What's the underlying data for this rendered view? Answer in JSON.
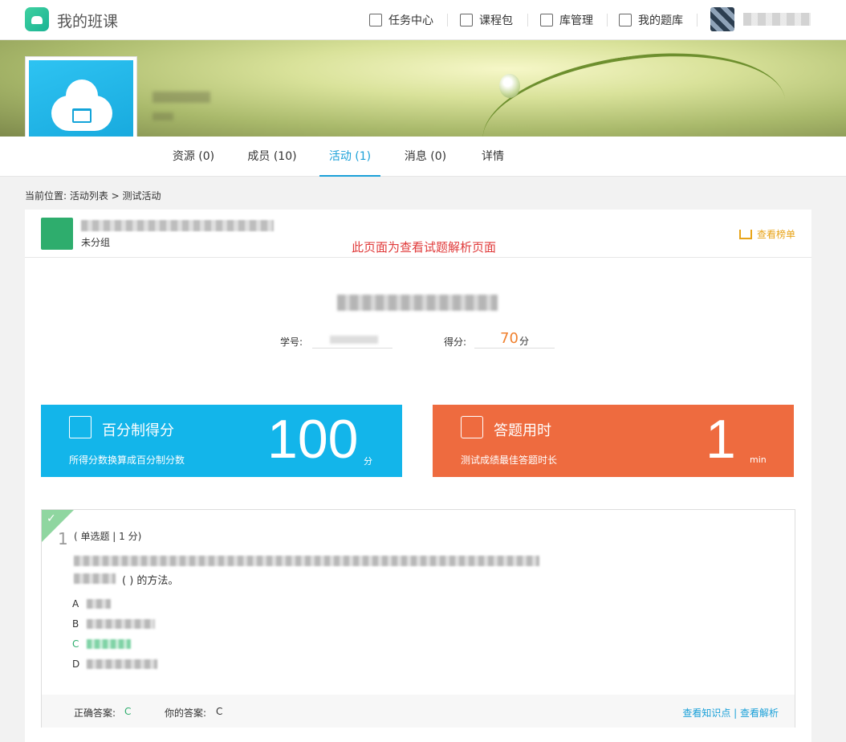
{
  "header": {
    "app_title": "我的班课",
    "nav": [
      {
        "label": "任务中心",
        "icon": "clipboard-icon"
      },
      {
        "label": "课程包",
        "icon": "box-icon"
      },
      {
        "label": "库管理",
        "icon": "archive-icon"
      },
      {
        "label": "我的题库",
        "icon": "layers-icon"
      }
    ]
  },
  "tabs": [
    {
      "label": "资源 (0)"
    },
    {
      "label": "成员 (10)"
    },
    {
      "label": "活动 (1)",
      "active": true
    },
    {
      "label": "消息 (0)"
    },
    {
      "label": "详情"
    }
  ],
  "breadcrumb": "当前位置: 活动列表 > 测试活动",
  "activity": {
    "group": "未分组",
    "note": "此页面为查看试题解析页面",
    "rank_link": "查看榜单"
  },
  "student": {
    "id_label": "学号:",
    "score_label": "得分:",
    "score": "70",
    "score_unit": "分"
  },
  "panels": {
    "percent": {
      "title": "百分制得分",
      "subtitle": "所得分数换算成百分制分数",
      "value": "100",
      "unit": "分",
      "color": "#13b5ea"
    },
    "time": {
      "title": "答题用时",
      "subtitle": "测试成绩最佳答题时长",
      "value": "1",
      "unit": "min",
      "color": "#ee6b3f"
    }
  },
  "question": {
    "number": "1",
    "type": "( 单选题 | 1 分)",
    "stem_tail": "( ) 的方法。",
    "options": [
      "A",
      "B",
      "C",
      "D"
    ],
    "correct_label": "正确答案:",
    "correct": "C",
    "yours_label": "你的答案:",
    "yours": "C",
    "links": "查看知识点 | 查看解析"
  }
}
